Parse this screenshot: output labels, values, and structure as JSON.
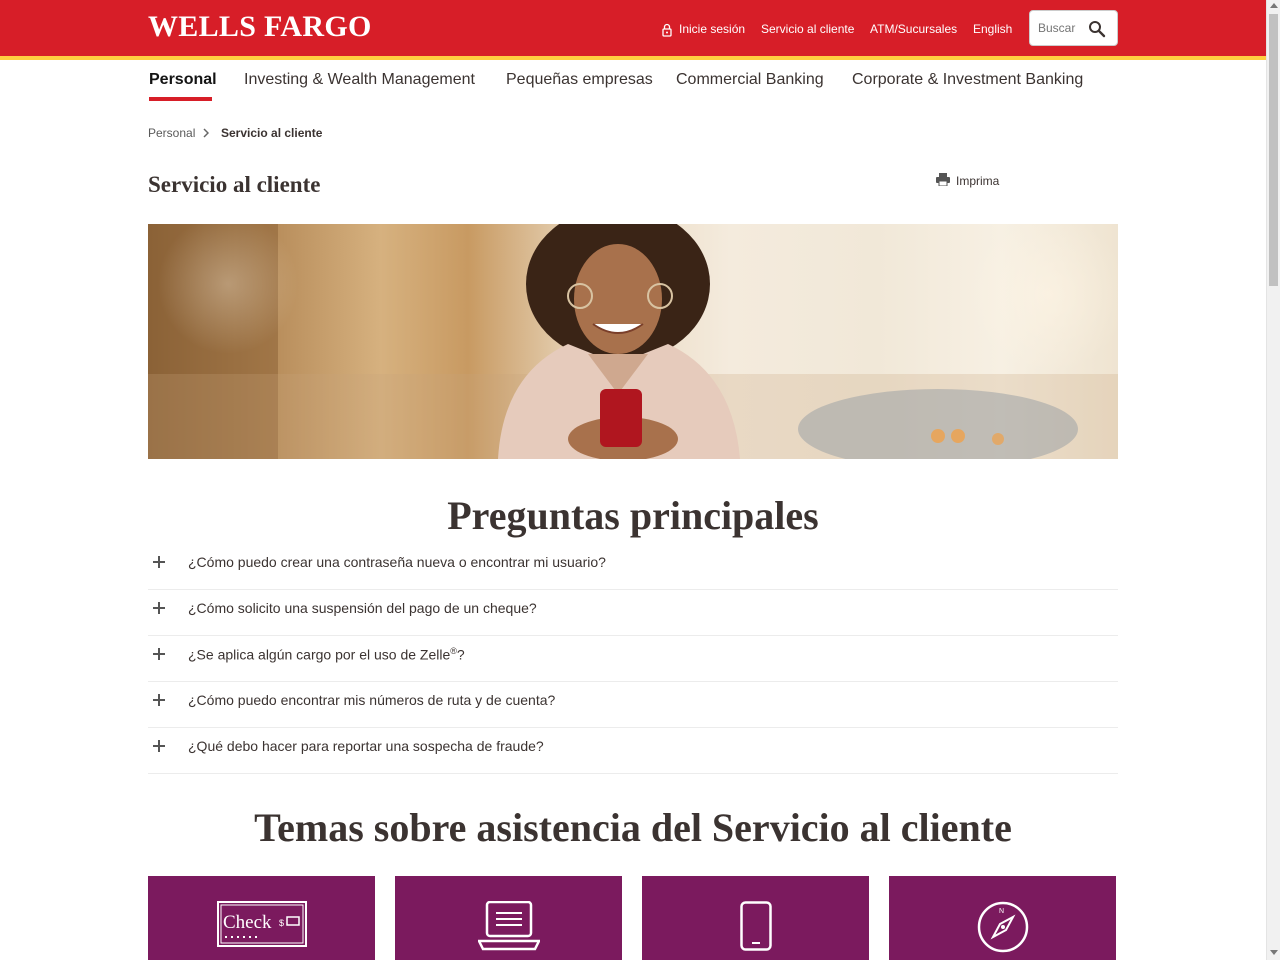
{
  "header": {
    "logo": "WELLS FARGO",
    "sign_in": "Inicie sesión",
    "customer_service": "Servicio al cliente",
    "atm": "ATM/Sucursales",
    "language": "English",
    "search_placeholder": "Buscar"
  },
  "main_nav": [
    {
      "label": "Personal",
      "active": true
    },
    {
      "label": "Investing & Wealth Management"
    },
    {
      "label": "Pequeñas empresas"
    },
    {
      "label": "Commercial Banking"
    },
    {
      "label": "Corporate & Investment Banking"
    }
  ],
  "breadcrumb": [
    "Personal",
    "Servicio al cliente"
  ],
  "page_title": "Servicio al cliente",
  "print_label": "Imprima",
  "faq": {
    "title": "Preguntas principales",
    "items": [
      "¿Cómo puedo crear una contraseña nueva o encontrar mi usuario?",
      "¿Cómo solicito una suspensión del pago de un cheque?",
      "¿Se aplica algún cargo por el uso de Zelle",
      "¿Cómo puedo encontrar mis números de ruta y de cuenta?",
      "¿Qué debo hacer para reportar una sospecha de fraude?"
    ],
    "zelle_mark": "®",
    "zelle_suffix": "?"
  },
  "topics": {
    "title": "Temas sobre asistencia del Servicio al cliente",
    "tiles": [
      {
        "icon": "check-icon",
        "icon_text": "Check"
      },
      {
        "icon": "laptop-icon"
      },
      {
        "icon": "mobile-phone-icon"
      },
      {
        "icon": "compass-icon"
      }
    ]
  },
  "colors": {
    "brand_red": "#d71e28",
    "brand_gold": "#ffcd41",
    "tile_purple": "#7b1a5e"
  }
}
